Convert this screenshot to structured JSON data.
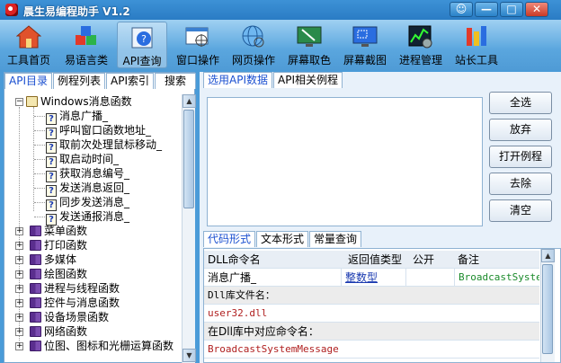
{
  "window": {
    "title": "晨生易编程助手 V1.2"
  },
  "titlebar_buttons": [
    {
      "name": "skin-button",
      "label": "☺"
    },
    {
      "name": "minimize-button",
      "label": "—"
    },
    {
      "name": "maximize-button",
      "label": "□"
    },
    {
      "name": "close-button",
      "label": "✕"
    }
  ],
  "toolbar": [
    {
      "label": "工具首页",
      "icon": "home-icon"
    },
    {
      "label": "易语言类",
      "icon": "cubes-icon"
    },
    {
      "label": "API查询",
      "icon": "api-help-icon"
    },
    {
      "label": "窗口操作",
      "icon": "window-target-icon"
    },
    {
      "label": "网页操作",
      "icon": "globe-target-icon"
    },
    {
      "label": "屏幕取色",
      "icon": "screen-color-icon"
    },
    {
      "label": "屏幕截图",
      "icon": "screenshot-icon"
    },
    {
      "label": "进程管理",
      "icon": "process-chart-icon"
    },
    {
      "label": "站长工具",
      "icon": "webmaster-tools-icon"
    }
  ],
  "left_tabs": [
    "API目录",
    "例程列表",
    "API索引",
    "搜索"
  ],
  "tree": {
    "root": "Windows消息函数",
    "children": [
      "消息广播_",
      "呼叫窗口函数地址_",
      "取前次处理鼠标移动_",
      "取启动时间_",
      "获取消息编号_",
      "发送消息返回_",
      "同步发送消息_",
      "发送通报消息_"
    ],
    "categories": [
      "菜单函数",
      "打印函数",
      "多媒体",
      "绘图函数",
      "进程与线程函数",
      "控件与消息函数",
      "设备场景函数",
      "网络函数",
      "位图、图标和光栅运算函数"
    ]
  },
  "right_tabs": [
    "选用API数据",
    "API相关例程"
  ],
  "action_buttons": [
    "全选",
    "放弃",
    "打开例程",
    "去除",
    "清空"
  ],
  "lower_tabs": [
    "代码形式",
    "文本形式",
    "常量查询"
  ],
  "table": {
    "headers": [
      "DLL命令名",
      "返回值类型",
      "公开",
      "备注"
    ],
    "command_name": "消息广播_",
    "return_type": "整数型",
    "public": "",
    "remark": "BroadcastSystemMessage",
    "dll_label": "Dll库文件名：",
    "dll_value": "user32.dll",
    "cmd_label": "在Dll库中对应命令名：",
    "cmd_value": "BroadcastSystemMessage"
  }
}
